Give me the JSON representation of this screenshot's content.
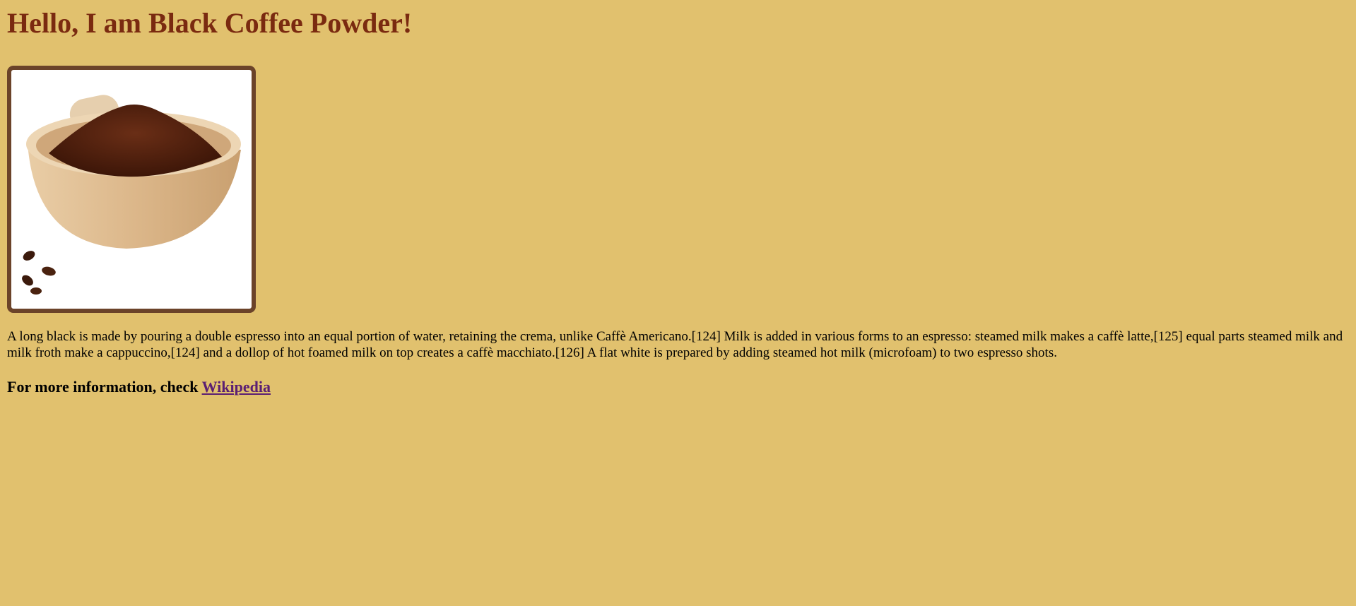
{
  "heading": "Hello, I am Black Coffee Powder!",
  "image": {
    "alt": "Black coffee powder in a wooden bowl"
  },
  "paragraph": "A long black is made by pouring a double espresso into an equal portion of water, retaining the crema, unlike Caffè Americano.[124] Milk is added in various forms to an espresso: steamed milk makes a caffè latte,[125] equal parts steamed milk and milk froth make a cappuccino,[124] and a dollop of hot foamed milk on top creates a caffè macchiato.[126] A flat white is prepared by adding steamed hot milk (microfoam) to two espresso shots.",
  "more_info": {
    "prefix": "For more information, check ",
    "link_label": "Wikipedia"
  },
  "colors": {
    "background": "#e1c16e",
    "heading": "#7a2a10",
    "frame_border": "#6b4329",
    "link": "#5b1f73"
  }
}
